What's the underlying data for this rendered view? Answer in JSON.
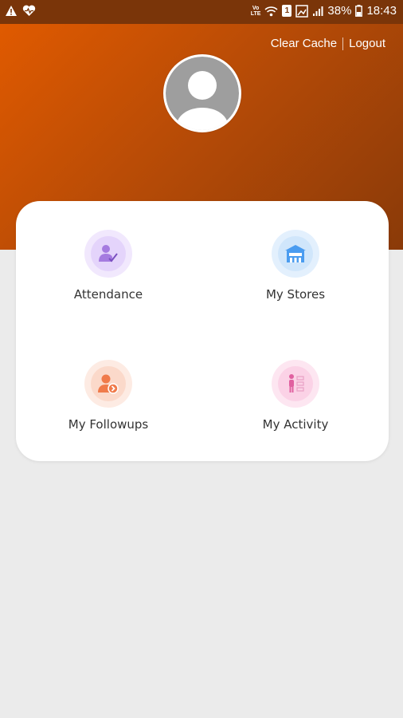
{
  "status_bar": {
    "left_icons": [
      "warning-icon",
      "heart-icon"
    ],
    "volte": "Vo\nLTE",
    "sim": "1",
    "battery": "38%",
    "time": "18:43"
  },
  "header": {
    "clear_cache": "Clear Cache",
    "logout": "Logout",
    "gradient": [
      "#e05a00",
      "#8a3a08"
    ]
  },
  "menu": [
    {
      "label": "Attendance",
      "icon": "attendance-icon",
      "color": "#a57be0"
    },
    {
      "label": "My Stores",
      "icon": "store-icon",
      "color": "#4a9cf0"
    },
    {
      "label": "My Followups",
      "icon": "followup-icon",
      "color": "#f07a4a"
    },
    {
      "label": "My Activity",
      "icon": "activity-icon",
      "color": "#e060a0"
    }
  ]
}
